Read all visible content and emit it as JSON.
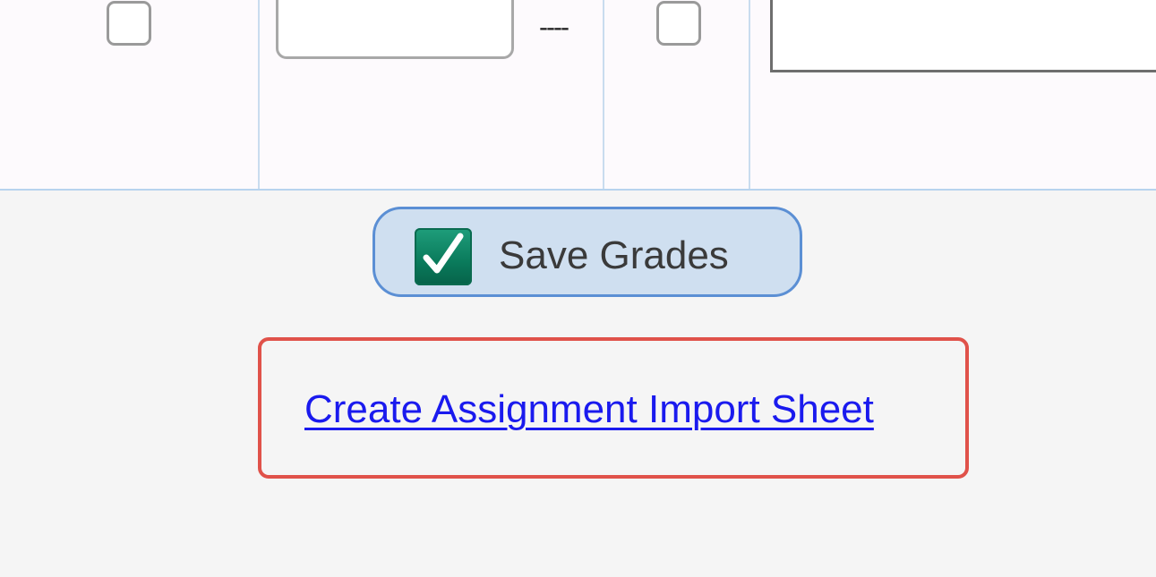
{
  "grade_row": {
    "placeholder_text": "----"
  },
  "actions": {
    "save_label": "Save Grades",
    "import_link_label": "Create Assignment Import Sheet"
  },
  "colors": {
    "accent": "#5b8fd4",
    "link": "#1a1aee",
    "highlight": "#e0524a",
    "save_icon": "#0a7a5b"
  },
  "icons": {
    "save": "check-icon"
  }
}
